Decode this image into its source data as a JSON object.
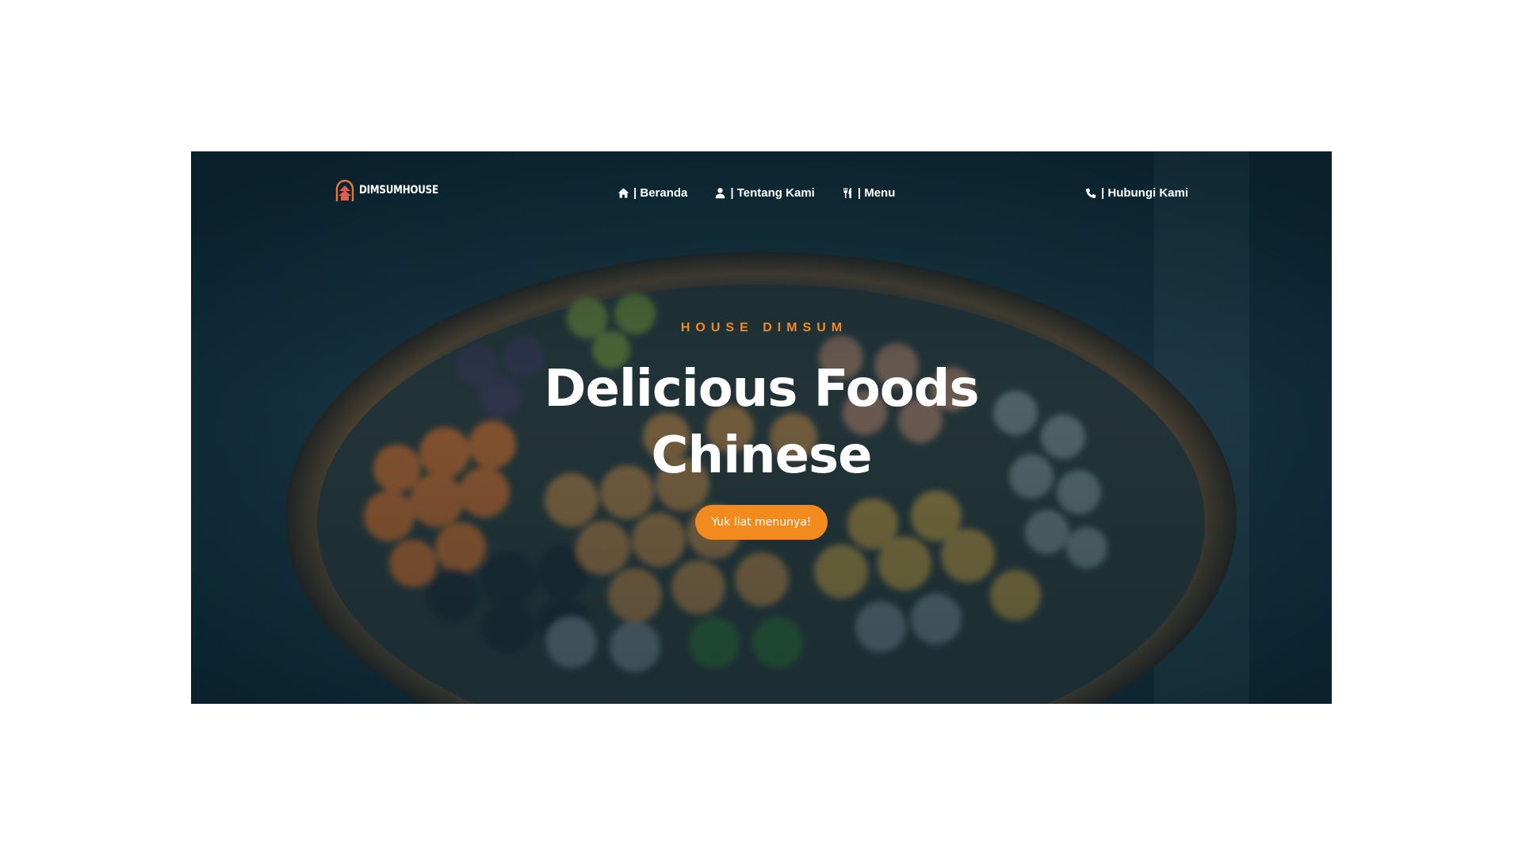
{
  "brand": {
    "logo_text": "DIMSUMHOUSE",
    "logo_icon": "pagoda-logo-icon"
  },
  "nav": {
    "items": [
      {
        "icon": "home-icon",
        "label": "| Beranda"
      },
      {
        "icon": "user-icon",
        "label": "| Tentang Kami"
      },
      {
        "icon": "utensils-icon",
        "label": "| Menu"
      }
    ],
    "contact": {
      "icon": "phone-icon",
      "label": "| Hubungi Kami"
    }
  },
  "hero": {
    "eyebrow": "HOUSE DIMSUM",
    "headline_line1": "Delicious Foods",
    "headline_line2": "Chinese",
    "cta_label": "Yuk liat menunya!",
    "background": "steamer-basket-dimsum-photo"
  },
  "colors": {
    "accent": "#f28a1e",
    "overlay": "#0f2a35",
    "text": "#ffffff"
  }
}
